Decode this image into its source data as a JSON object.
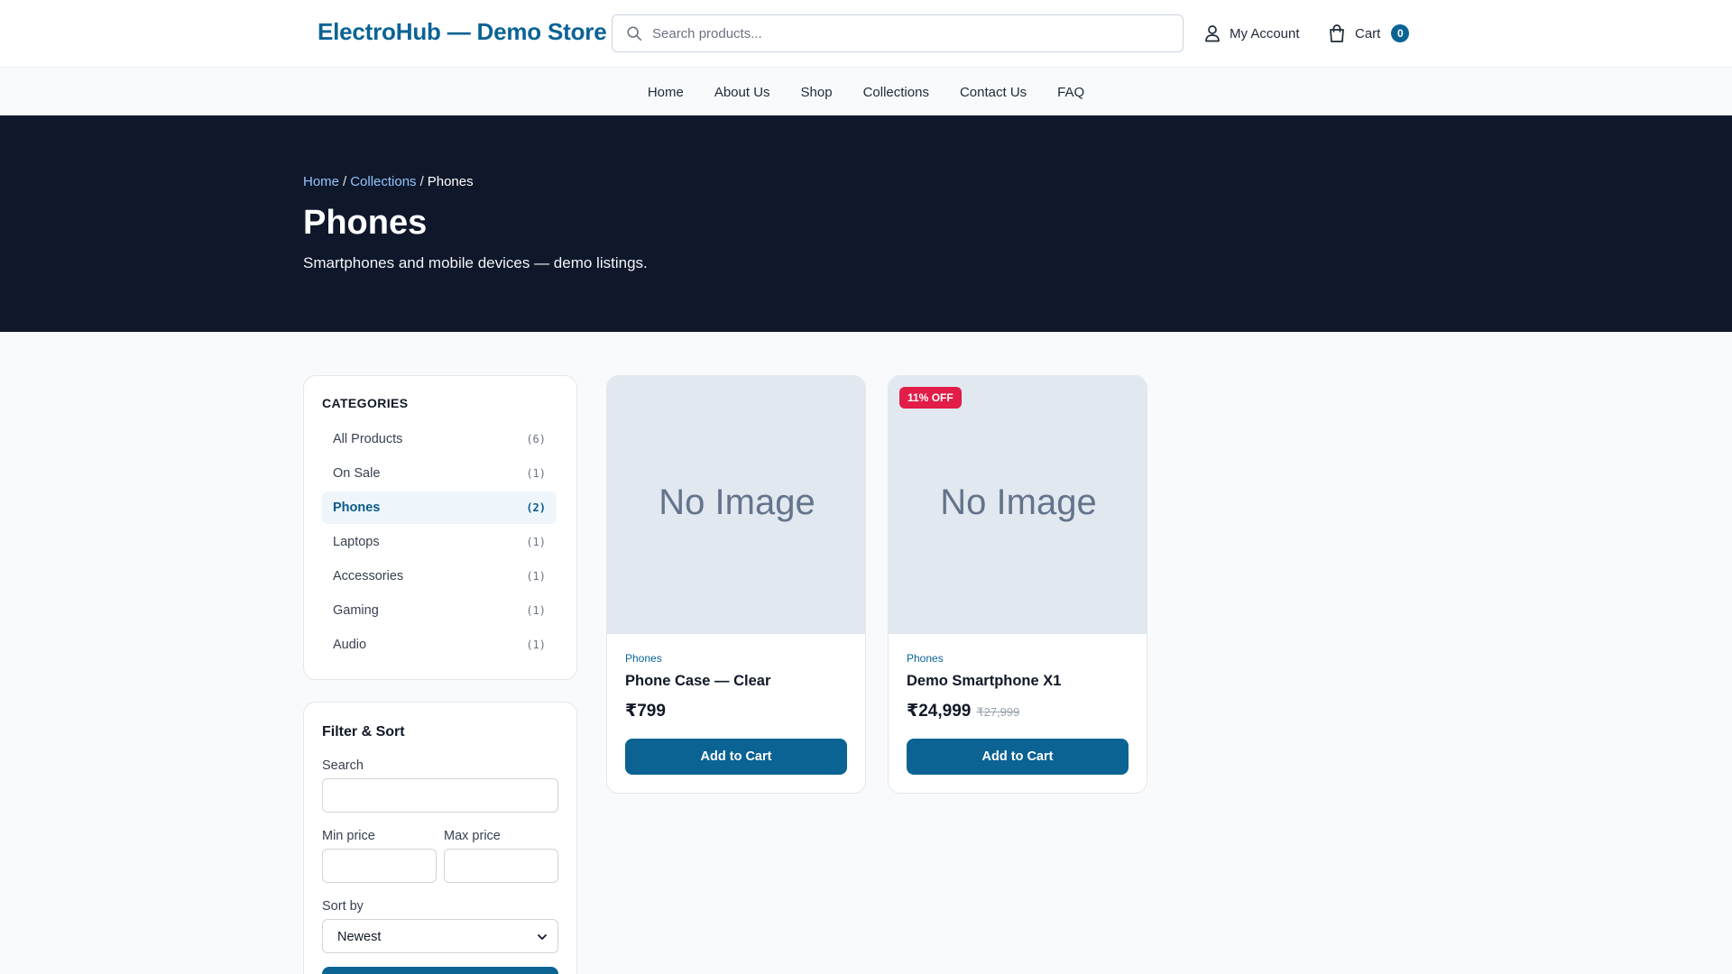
{
  "header": {
    "brand": "ElectroHub — Demo Store",
    "search_placeholder": "Search products...",
    "account_label": "My Account",
    "cart_label": "Cart",
    "cart_count": "0"
  },
  "nav": [
    "Home",
    "About Us",
    "Shop",
    "Collections",
    "Contact Us",
    "FAQ"
  ],
  "hero": {
    "breadcrumb": [
      "Home",
      "Collections",
      "Phones"
    ],
    "breadcrumb_separator": "/",
    "title": "Phones",
    "subtitle": "Smartphones and mobile devices — demo listings."
  },
  "categories": {
    "title": "CATEGORIES",
    "items": [
      {
        "label": "All Products",
        "count": "(6)"
      },
      {
        "label": "On Sale",
        "count": "(1)"
      },
      {
        "label": "Phones",
        "count": "(2)"
      },
      {
        "label": "Laptops",
        "count": "(1)"
      },
      {
        "label": "Accessories",
        "count": "(1)"
      },
      {
        "label": "Gaming",
        "count": "(1)"
      },
      {
        "label": "Audio",
        "count": "(1)"
      }
    ],
    "active": "Phones"
  },
  "filter": {
    "title": "Filter & Sort",
    "search_label": "Search",
    "search_value": "",
    "min_label": "Min price",
    "min_value": "",
    "max_label": "Max price",
    "max_value": "",
    "sort_label": "Sort by",
    "sort_value": "Newest"
  },
  "products": [
    {
      "image_text": "No Image",
      "badge": "",
      "category": "Phones",
      "name": "Phone Case — Clear",
      "price": "₹799",
      "old_price": "",
      "button": "Add to Cart"
    },
    {
      "image_text": "No Image",
      "badge": "11% OFF",
      "category": "Phones",
      "name": "Demo Smartphone X1",
      "price": "₹24,999",
      "old_price": "₹27,999",
      "button": "Add to Cart"
    }
  ],
  "colors": {
    "brand": "#0b6394",
    "hero_bg": "#0f172a",
    "sale_badge": "#e11d48",
    "placeholder_bg": "#e2e8f0"
  }
}
